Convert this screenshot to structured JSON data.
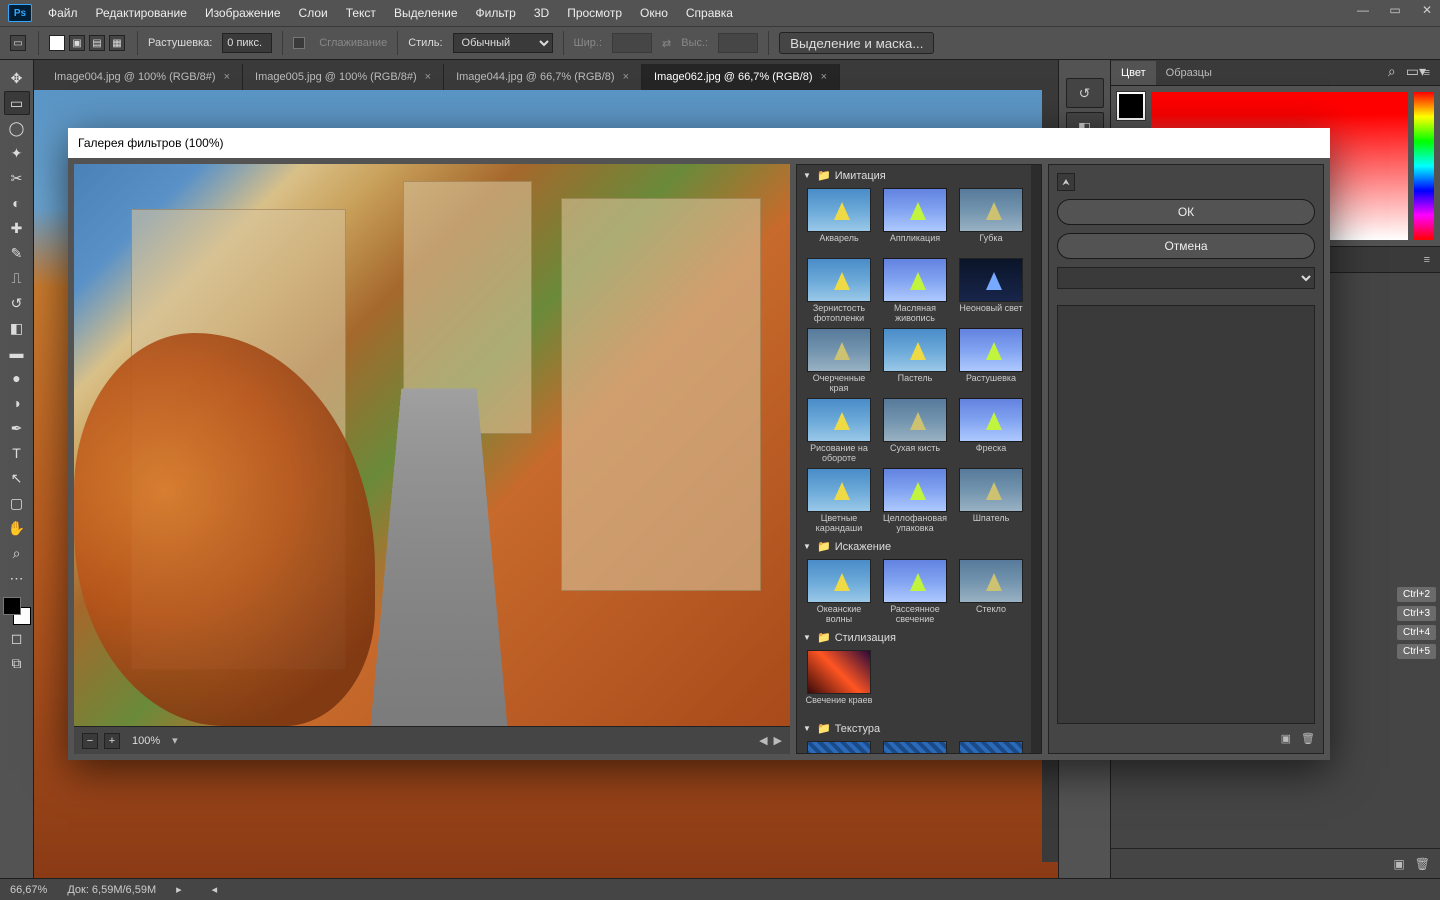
{
  "menu": {
    "items": [
      "Файл",
      "Редактирование",
      "Изображение",
      "Слои",
      "Текст",
      "Выделение",
      "Фильтр",
      "3D",
      "Просмотр",
      "Окно",
      "Справка"
    ]
  },
  "optionsbar": {
    "feather_label": "Растушевка:",
    "feather_value": "0 пикс.",
    "antialias": "Сглаживание",
    "style_label": "Стиль:",
    "style_value": "Обычный",
    "width_label": "Шир.:",
    "height_label": "Выс.:",
    "refine": "Выделение и маска..."
  },
  "tabs": [
    {
      "title": "Image004.jpg @ 100% (RGB/8#)",
      "active": false
    },
    {
      "title": "Image005.jpg @ 100% (RGB/8#)",
      "active": false
    },
    {
      "title": "Image044.jpg @ 66,7% (RGB/8)",
      "active": false
    },
    {
      "title": "Image062.jpg @ 66,7% (RGB/8)",
      "active": true
    }
  ],
  "panels": {
    "color_tab": "Цвет",
    "swatch_tab": "Образцы",
    "shortcuts": [
      "Ctrl+2",
      "Ctrl+3",
      "Ctrl+4",
      "Ctrl+5"
    ]
  },
  "status": {
    "zoom": "66,67%",
    "doc": "Док: 6,59M/6,59M"
  },
  "modal": {
    "title": "Галерея фильтров (100%)",
    "ok": "ОК",
    "cancel": "Отмена",
    "zoom": "100%",
    "categories": [
      {
        "name": "Имитация",
        "open": true,
        "filters": [
          "Акварель",
          "Аппликация",
          "Губка",
          "Зернистость фотопленки",
          "Масляная живопись",
          "Неоновый свет",
          "Очерченные края",
          "Пастель",
          "Растушевка",
          "Рисование на обороте",
          "Сухая кисть",
          "Фреска",
          "Цветные карандаши",
          "Целлофановая упаковка",
          "Шпатель"
        ]
      },
      {
        "name": "Искажение",
        "open": true,
        "filters": [
          "Океанские волны",
          "Рассеянное свечение",
          "Стекло"
        ]
      },
      {
        "name": "Стилизация",
        "open": true,
        "filters": [
          "Свечение краев"
        ]
      },
      {
        "name": "Текстура",
        "open": true,
        "filters": [
          "",
          "",
          ""
        ]
      }
    ]
  }
}
